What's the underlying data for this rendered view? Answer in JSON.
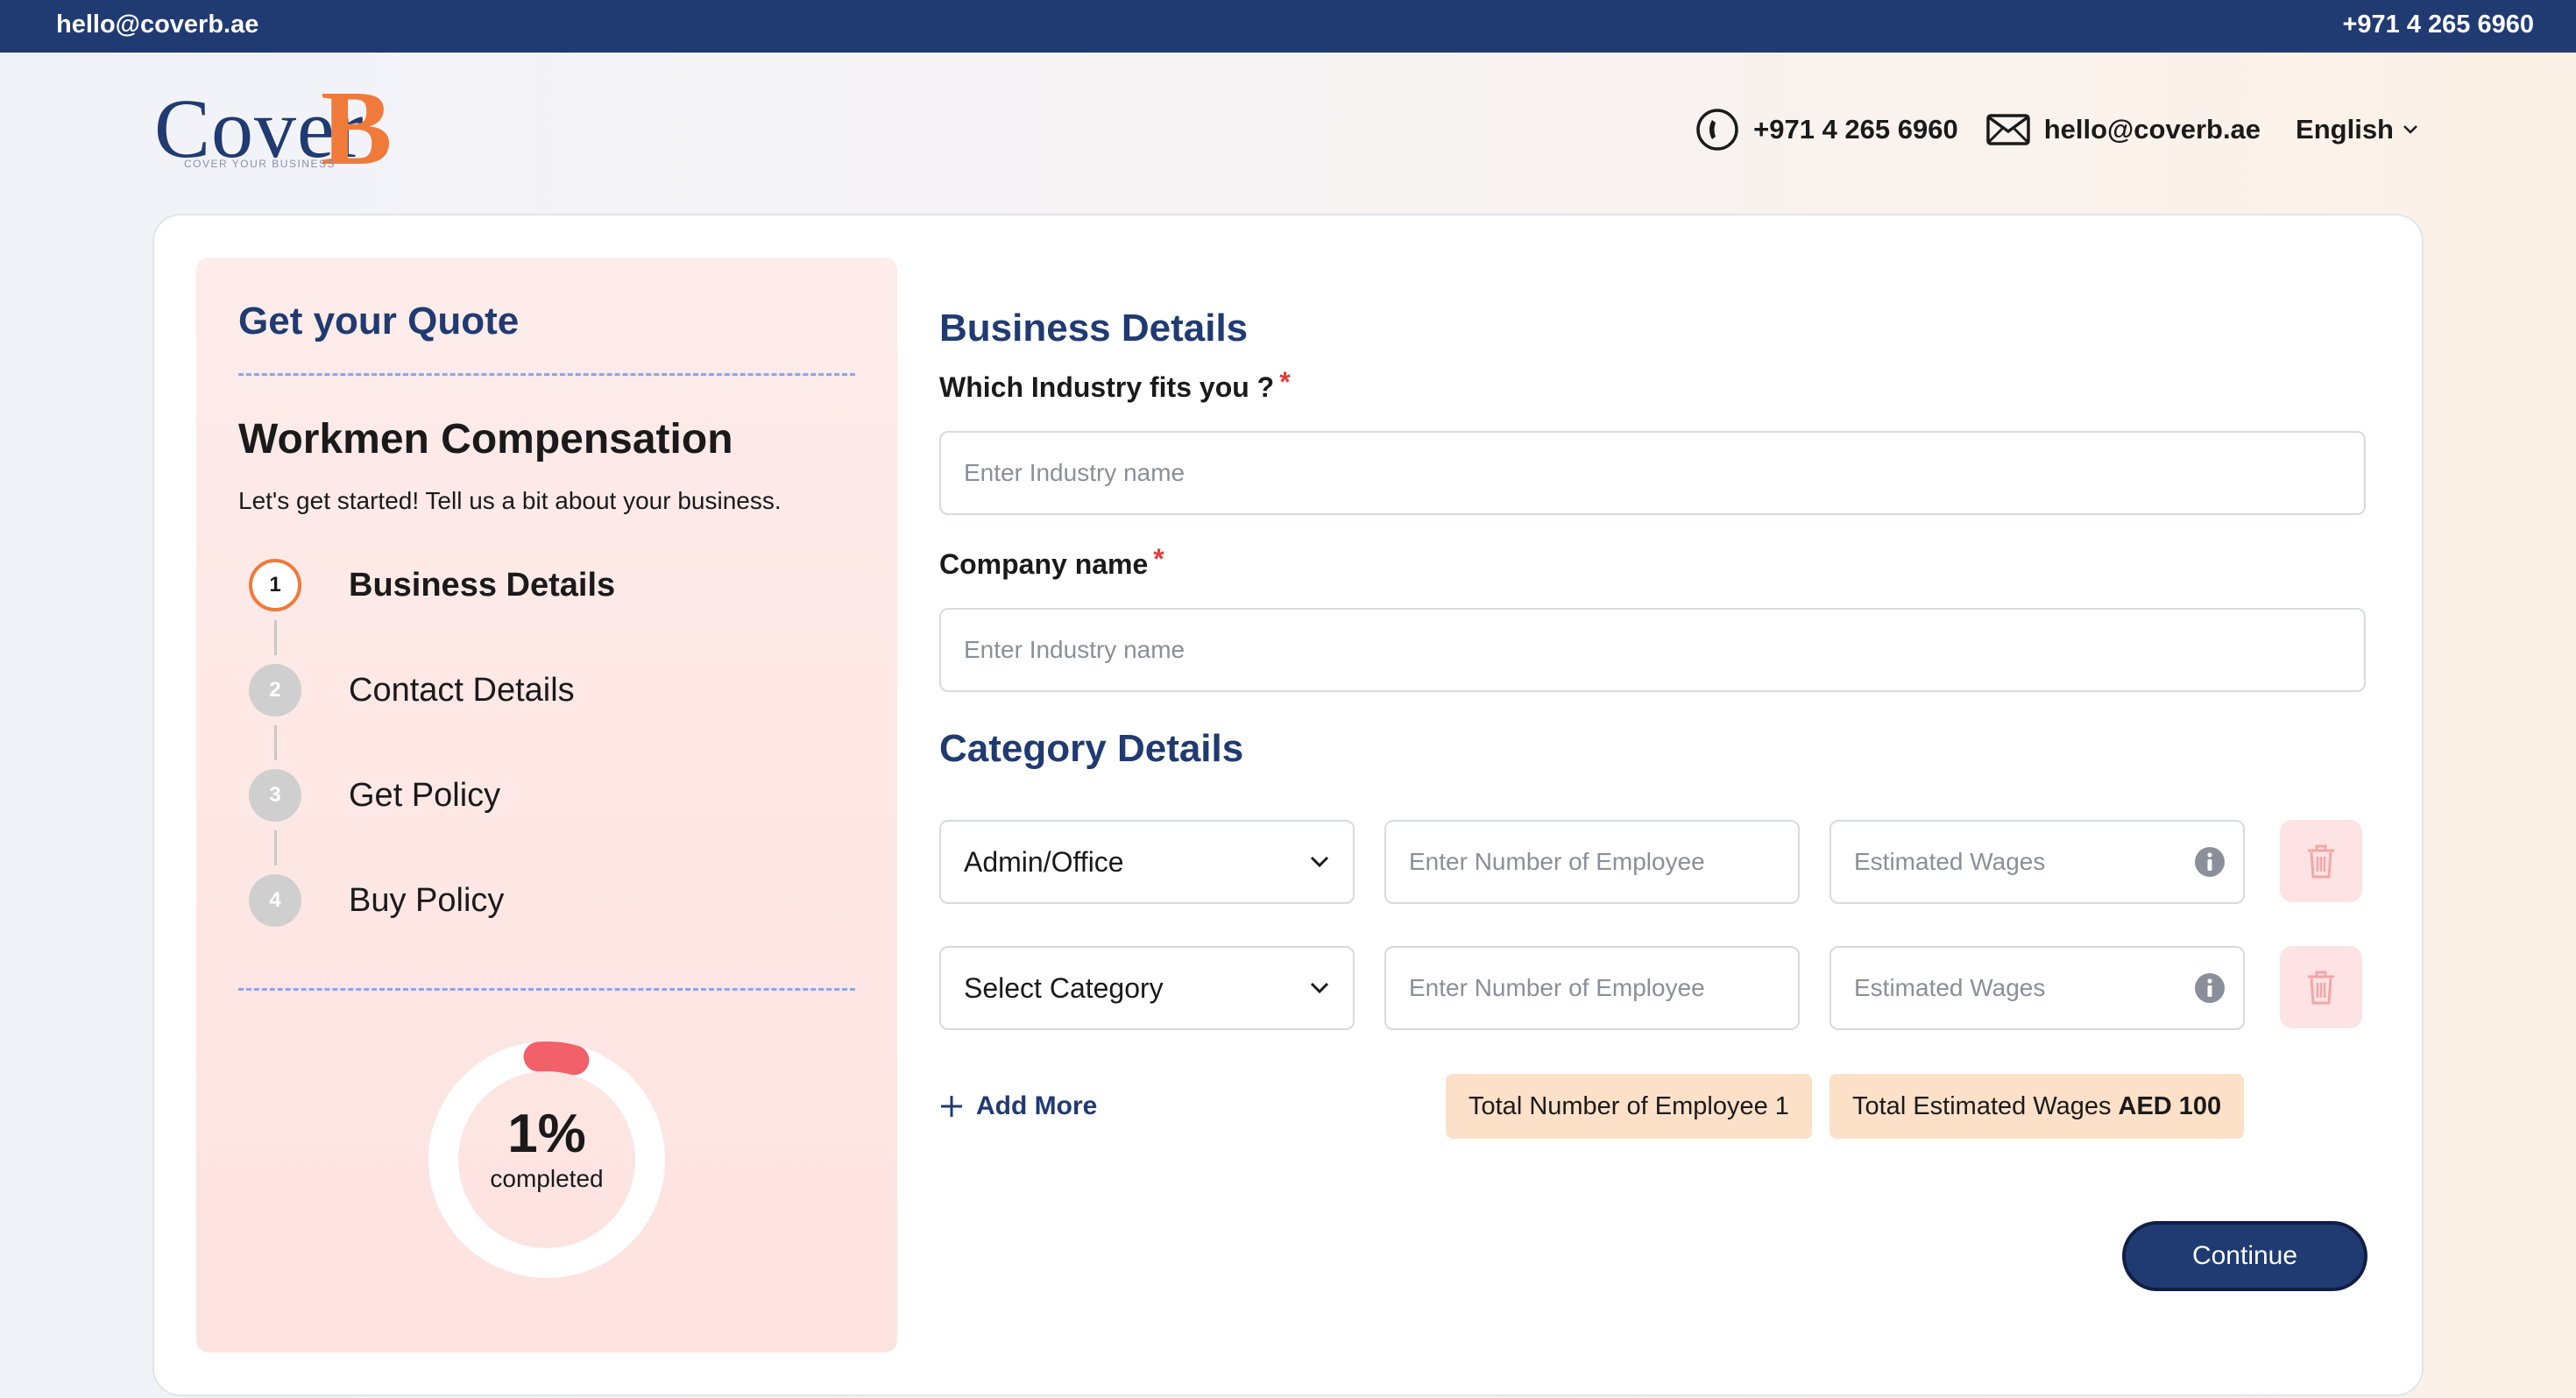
{
  "topbar": {
    "email": "hello@coverb.ae",
    "phone": "+971 4 265 6960"
  },
  "logo": {
    "word": "Cover",
    "mark": "B",
    "tagline": "COVER YOUR BUSINESS"
  },
  "header": {
    "phone": "+971 4 265 6960",
    "email": "hello@coverb.ae",
    "language": "English",
    "icons": {
      "phone": "phone-icon",
      "email": "envelope-icon",
      "language": "chevron-down-icon"
    }
  },
  "sidebar": {
    "heading": "Get your Quote",
    "title": "Workmen Compensation",
    "subtitle": "Let's get started! Tell us a bit about your business.",
    "steps": [
      {
        "number": "1",
        "label": "Business Details",
        "state": "active"
      },
      {
        "number": "2",
        "label": "Contact Details",
        "state": "pending"
      },
      {
        "number": "3",
        "label": "Get Policy",
        "state": "pending"
      },
      {
        "number": "4",
        "label": "Buy Policy",
        "state": "pending"
      }
    ],
    "progress": {
      "percent_text": "1%",
      "label": "completed",
      "percent_value": 0.01
    }
  },
  "form": {
    "business_heading": "Business Details",
    "industry_label": "Which Industry fits you ?",
    "industry_placeholder": "Enter Industry name",
    "company_label": "Company name",
    "company_placeholder": "Enter Industry name",
    "required_mark": "*",
    "category_heading": "Category Details",
    "categories": [
      {
        "category": "Admin/Office",
        "employees_placeholder": "Enter Number of Employee",
        "wages_placeholder": "Estimated Wages"
      },
      {
        "category": "Select Category",
        "employees_placeholder": "Enter Number of Employee",
        "wages_placeholder": "Estimated Wages"
      }
    ],
    "add_more": "Add More",
    "total_employees_label": "Total Number of Employee",
    "total_employees_value": "1",
    "total_wages_label": "Total Estimated Wages",
    "total_wages_value": "AED 100",
    "continue": "Continue"
  },
  "colors": {
    "brand_navy": "#203a72",
    "accent_orange": "#f07a3a",
    "progress_red": "#f2606a",
    "required_red": "#e23b3b",
    "totals_bg": "#fde0c8"
  }
}
